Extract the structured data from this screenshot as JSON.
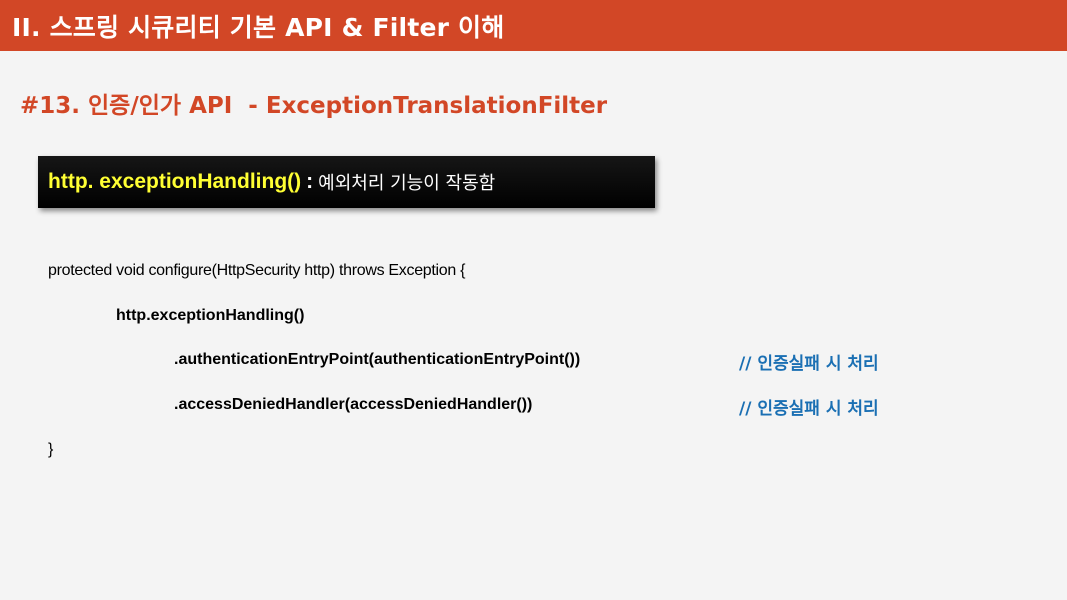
{
  "header": {
    "title": "II. 스프링 시큐리티 기본 API & Filter 이해"
  },
  "subtitle": "#13. 인증/인가 API  - ExceptionTranslationFilter",
  "callout": {
    "method": "http. exceptionHandling()",
    "separator": ":",
    "description": "예외처리 기능이 작동함"
  },
  "code": {
    "line1": "protected void configure(HttpSecurity http) throws Exception {",
    "line2": "http.exceptionHandling()",
    "line3": ".authenticationEntryPoint(authenticationEntryPoint())",
    "line3_comment": "// 인증실패 시 처리",
    "line4": ".accessDeniedHandler(accessDeniedHandler())",
    "line4_comment": "// 인증실패 시 처리",
    "line5": "}"
  },
  "colors": {
    "accent": "#d24726",
    "callout_highlight": "#ffff33",
    "comment": "#1a6fb3"
  }
}
